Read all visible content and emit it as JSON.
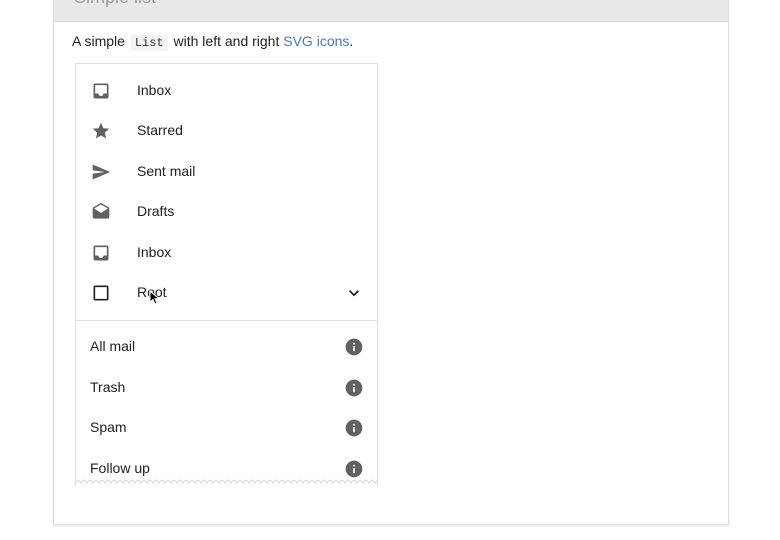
{
  "section": {
    "title": "Simple list",
    "description_prefix": "A simple",
    "description_code": "List",
    "description_middle": "with left and right",
    "description_link": "SVG icons",
    "description_suffix": "."
  },
  "list": {
    "primary_items": [
      {
        "label": "Inbox",
        "icon": "inbox-icon"
      },
      {
        "label": "Starred",
        "icon": "star-icon"
      },
      {
        "label": "Sent mail",
        "icon": "send-icon"
      },
      {
        "label": "Drafts",
        "icon": "drafts-icon"
      },
      {
        "label": "Inbox",
        "icon": "inbox-icon"
      },
      {
        "label": "Root",
        "icon": "checkbox-icon",
        "right_icon": "chevron-down-icon"
      }
    ],
    "secondary_items": [
      {
        "label": "All mail",
        "right_icon": "info-icon"
      },
      {
        "label": "Trash",
        "right_icon": "info-icon"
      },
      {
        "label": "Spam",
        "right_icon": "info-icon"
      },
      {
        "label": "Follow up",
        "right_icon": "info-icon"
      }
    ]
  },
  "colors": {
    "icon": "#616161",
    "link": "#3f7bbf",
    "header_bg": "#e8e8e8"
  }
}
